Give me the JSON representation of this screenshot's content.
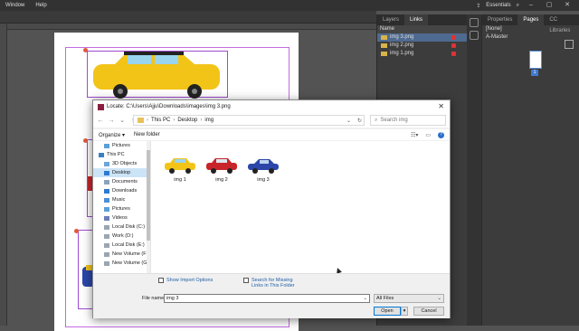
{
  "menu": {
    "items": [
      "Window",
      "Help"
    ],
    "workspace": "Essentials"
  },
  "links_panel": {
    "tabs": [
      "Layers",
      "Links"
    ],
    "header": "Name",
    "rows": [
      "img 3.png",
      "img 2.png",
      "img 1.png"
    ]
  },
  "pages_panel": {
    "tabs": [
      "Properties",
      "Pages",
      "CC Libraries"
    ],
    "none_label": "[None]",
    "master_label": "A-Master",
    "page_number": "1"
  },
  "dialog": {
    "title": "Locate: C:\\Users\\Ajju\\Downloads\\images\\img 3.png",
    "breadcrumb": [
      "This PC",
      "Desktop",
      "img"
    ],
    "search_placeholder": "Search img",
    "organize": "Organize",
    "new_folder": "New folder",
    "nav_items": [
      "Pictures",
      "This PC",
      "3D Objects",
      "Desktop",
      "Documents",
      "Downloads",
      "Music",
      "Pictures",
      "Videos",
      "Local Disk (C:)",
      "Work (D:)",
      "Local Disk (E:)",
      "New Volume (F:)",
      "New Volume (G:"
    ],
    "files": [
      "img 1",
      "img 2",
      "img 3"
    ],
    "show_import_options": "Show Import Options",
    "search_missing": "Search for Missing Links in This Folder",
    "file_name_label": "File name:",
    "file_name_value": "img 3",
    "file_type": "All Files",
    "open": "Open",
    "cancel": "Cancel"
  },
  "colors": {
    "selected_row": "#4f6a90",
    "nav_selected": "#cce4f7",
    "primary_border": "#0078d7"
  }
}
